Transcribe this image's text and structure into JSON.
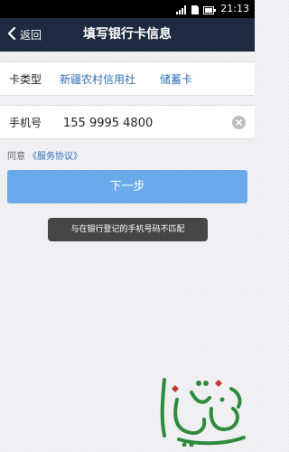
{
  "status_bar": {
    "time": "21:13"
  },
  "header": {
    "back_label": "返回",
    "title": "填写银行卡信息"
  },
  "card_info": {
    "label": "卡类型",
    "bank_name": "新疆农村信用社",
    "card_kind": "储蓄卡"
  },
  "phone": {
    "label": "手机号",
    "value": "155 9995 4800"
  },
  "agreement": {
    "prefix": "同意",
    "link_text": "《服务协议》"
  },
  "next_button": {
    "label": "下一步"
  },
  "toast": {
    "message": "与在银行登记的手机号码不匹配"
  },
  "colors": {
    "header_bg": "#1d2a3f",
    "link_blue": "#2f6fb8",
    "button_blue": "#6aaaea",
    "watermark_green": "#2e8b3c"
  }
}
